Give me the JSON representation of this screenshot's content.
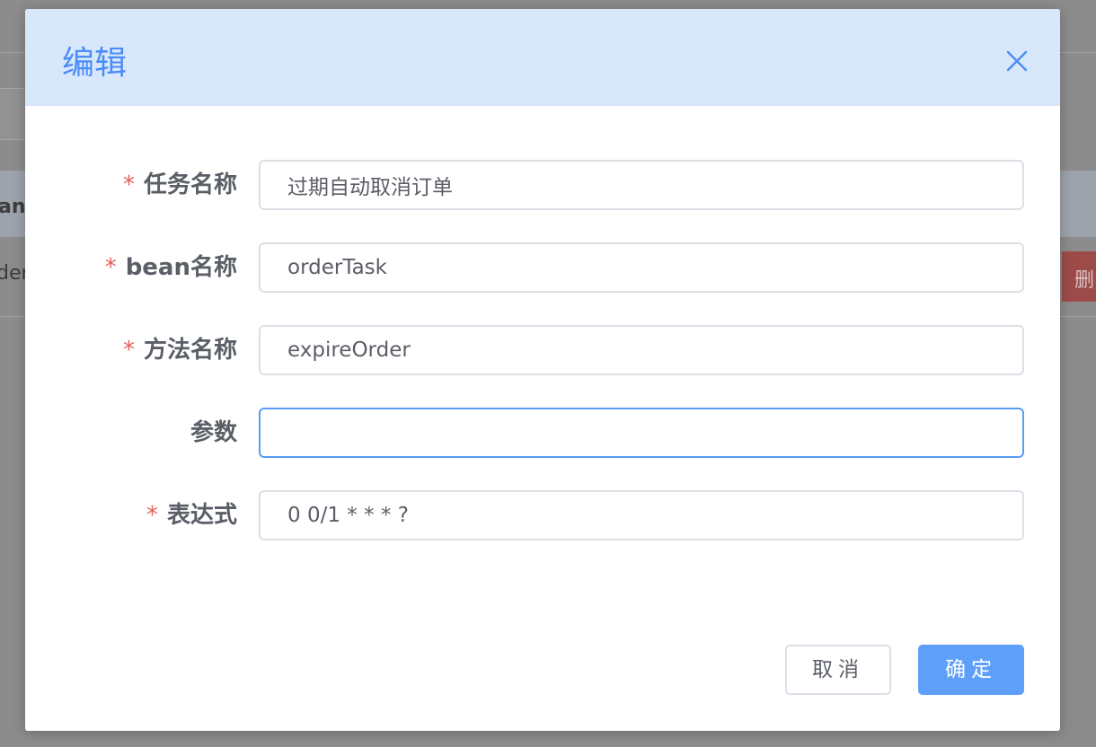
{
  "background": {
    "header_fragment": "an名",
    "row_fragment": "der",
    "delete_fragment": "删"
  },
  "dialog": {
    "title": "编辑",
    "close_icon": "close-icon",
    "fields": [
      {
        "label": "任务名称",
        "required": true,
        "value": "过期自动取消订单",
        "placeholder": ""
      },
      {
        "label": "bean名称",
        "required": true,
        "value": "orderTask",
        "placeholder": ""
      },
      {
        "label": "方法名称",
        "required": true,
        "value": "expireOrder",
        "placeholder": ""
      },
      {
        "label": "参数",
        "required": false,
        "value": "",
        "placeholder": ""
      },
      {
        "label": "表达式",
        "required": true,
        "value": "0 0/1 * * * ?",
        "placeholder": ""
      }
    ],
    "required_mark": "*",
    "cancel_label": "取消",
    "confirm_label": "确定"
  },
  "colors": {
    "accent": "#4a8cf7",
    "required": "#e4605b",
    "header_bg": "#d9e7fb",
    "primary_button": "#5e9ff9"
  }
}
